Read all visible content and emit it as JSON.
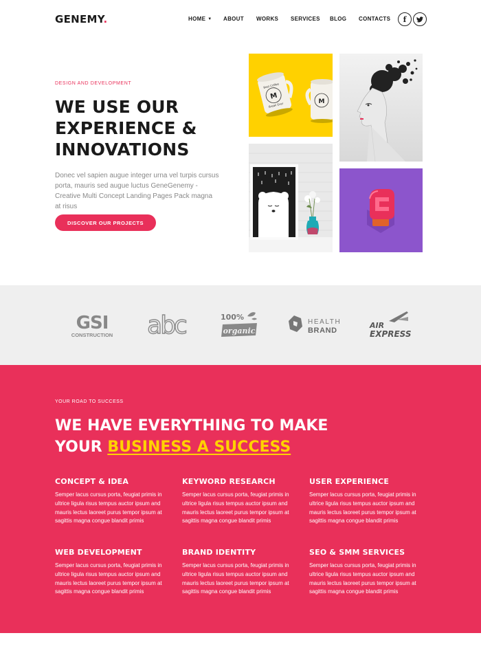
{
  "header": {
    "logo_text": "GENEMY",
    "logo_dot": ".",
    "nav": [
      {
        "label": "HOME",
        "has_dropdown": true
      },
      {
        "label": "ABOUT"
      },
      {
        "label": "WORKS"
      },
      {
        "label": "SERVICES"
      },
      {
        "label": "BLOG"
      },
      {
        "label": "CONTACTS"
      }
    ],
    "social": [
      {
        "icon": "facebook-icon",
        "glyph": "f"
      },
      {
        "icon": "twitter-icon"
      }
    ]
  },
  "hero": {
    "eyebrow": "DESIGN AND DEVELOPMENT",
    "title_lines": [
      "WE USE OUR",
      "EXPERIENCE &",
      "INNOVATIONS"
    ],
    "text": "Donec vel sapien augue integer urna vel turpis cursus porta, mauris sed augue luctus GeneGenemy - Creative Multi Concept Landing Pages Pack magna at risus",
    "button_label": "DISCOVER OUR PROJECTS"
  },
  "gallery": {
    "mug_text_a": "Best Coffee",
    "mug_text_b": "Break Ever",
    "mug_monogram": "M"
  },
  "clients": {
    "gsi": {
      "top": "GSI",
      "bottom": "CONSTRUCTION"
    },
    "abc": {
      "text": "abc"
    },
    "organic": {
      "top": "100%",
      "bottom": "organic"
    },
    "health": {
      "top": "HEALTH",
      "bottom": "BRAND"
    },
    "air": {
      "top": "AIR",
      "bottom": "EXPRESS"
    }
  },
  "features": {
    "eyebrow": "YOUR ROAD TO SUCCESS",
    "title_line1": "WE HAVE EVERYTHING TO MAKE",
    "title_line2_prefix": "YOUR ",
    "title_line2_highlight": "BUSINESS A SUCCESS",
    "items": [
      {
        "title": "CONCEPT & IDEA",
        "text": "Semper lacus cursus porta, feugiat primis in ultrice ligula risus tempus auctor ipsum and mauris lectus laoreet purus tempor ipsum at sagittis magna congue blandit primis"
      },
      {
        "title": "KEYWORD RESEARCH",
        "text": "Semper lacus cursus porta, feugiat primis in ultrice ligula risus tempus auctor ipsum and mauris lectus laoreet purus tempor ipsum at sagittis magna congue blandit primis"
      },
      {
        "title": "USER EXPERIENCE",
        "text": "Semper lacus cursus porta, feugiat primis in ultrice ligula risus tempus auctor ipsum and mauris lectus laoreet purus tempor ipsum at sagittis magna congue blandit primis"
      },
      {
        "title": "WEB DEVELOPMENT",
        "text": "Semper lacus cursus porta, feugiat primis in ultrice ligula risus tempus auctor ipsum and mauris lectus laoreet purus tempor ipsum at sagittis magna congue blandit primis"
      },
      {
        "title": "BRAND IDENTITY",
        "text": "Semper lacus cursus porta, feugiat primis in ultrice ligula risus tempus auctor ipsum and mauris lectus laoreet purus tempor ipsum at sagittis magna congue blandit primis"
      },
      {
        "title": "SEO & SMM SERVICES",
        "text": "Semper lacus cursus porta, feugiat primis in ultrice ligula risus tempus auctor ipsum and mauris lectus laoreet purus tempor ipsum at sagittis magna congue blandit primis"
      }
    ]
  },
  "colors": {
    "accent": "#e9305a",
    "highlight": "#ffd200",
    "dark": "#1a1a1a",
    "clients_bg": "#efefef"
  }
}
